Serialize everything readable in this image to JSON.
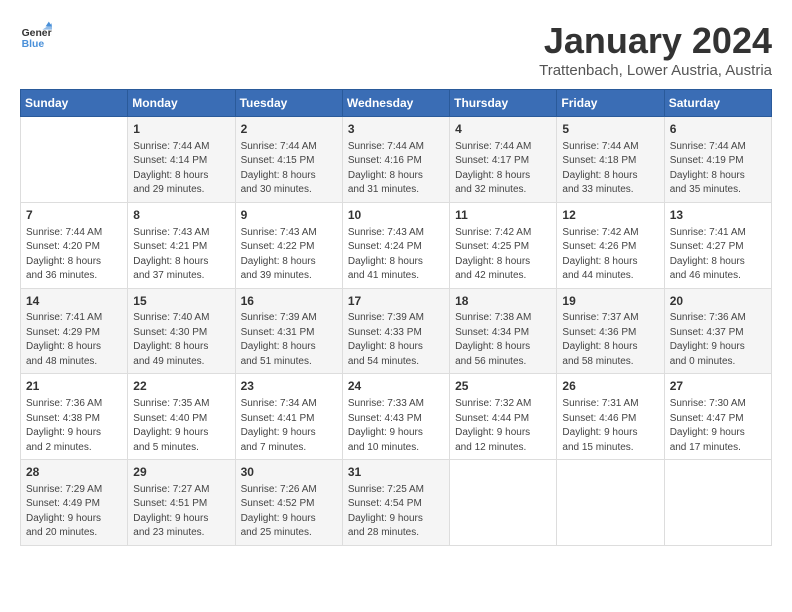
{
  "header": {
    "logo_line1": "General",
    "logo_line2": "Blue",
    "month": "January 2024",
    "location": "Trattenbach, Lower Austria, Austria"
  },
  "weekdays": [
    "Sunday",
    "Monday",
    "Tuesday",
    "Wednesday",
    "Thursday",
    "Friday",
    "Saturday"
  ],
  "weeks": [
    [
      {
        "day": "",
        "text": ""
      },
      {
        "day": "1",
        "text": "Sunrise: 7:44 AM\nSunset: 4:14 PM\nDaylight: 8 hours\nand 29 minutes."
      },
      {
        "day": "2",
        "text": "Sunrise: 7:44 AM\nSunset: 4:15 PM\nDaylight: 8 hours\nand 30 minutes."
      },
      {
        "day": "3",
        "text": "Sunrise: 7:44 AM\nSunset: 4:16 PM\nDaylight: 8 hours\nand 31 minutes."
      },
      {
        "day": "4",
        "text": "Sunrise: 7:44 AM\nSunset: 4:17 PM\nDaylight: 8 hours\nand 32 minutes."
      },
      {
        "day": "5",
        "text": "Sunrise: 7:44 AM\nSunset: 4:18 PM\nDaylight: 8 hours\nand 33 minutes."
      },
      {
        "day": "6",
        "text": "Sunrise: 7:44 AM\nSunset: 4:19 PM\nDaylight: 8 hours\nand 35 minutes."
      }
    ],
    [
      {
        "day": "7",
        "text": "Sunrise: 7:44 AM\nSunset: 4:20 PM\nDaylight: 8 hours\nand 36 minutes."
      },
      {
        "day": "8",
        "text": "Sunrise: 7:43 AM\nSunset: 4:21 PM\nDaylight: 8 hours\nand 37 minutes."
      },
      {
        "day": "9",
        "text": "Sunrise: 7:43 AM\nSunset: 4:22 PM\nDaylight: 8 hours\nand 39 minutes."
      },
      {
        "day": "10",
        "text": "Sunrise: 7:43 AM\nSunset: 4:24 PM\nDaylight: 8 hours\nand 41 minutes."
      },
      {
        "day": "11",
        "text": "Sunrise: 7:42 AM\nSunset: 4:25 PM\nDaylight: 8 hours\nand 42 minutes."
      },
      {
        "day": "12",
        "text": "Sunrise: 7:42 AM\nSunset: 4:26 PM\nDaylight: 8 hours\nand 44 minutes."
      },
      {
        "day": "13",
        "text": "Sunrise: 7:41 AM\nSunset: 4:27 PM\nDaylight: 8 hours\nand 46 minutes."
      }
    ],
    [
      {
        "day": "14",
        "text": "Sunrise: 7:41 AM\nSunset: 4:29 PM\nDaylight: 8 hours\nand 48 minutes."
      },
      {
        "day": "15",
        "text": "Sunrise: 7:40 AM\nSunset: 4:30 PM\nDaylight: 8 hours\nand 49 minutes."
      },
      {
        "day": "16",
        "text": "Sunrise: 7:39 AM\nSunset: 4:31 PM\nDaylight: 8 hours\nand 51 minutes."
      },
      {
        "day": "17",
        "text": "Sunrise: 7:39 AM\nSunset: 4:33 PM\nDaylight: 8 hours\nand 54 minutes."
      },
      {
        "day": "18",
        "text": "Sunrise: 7:38 AM\nSunset: 4:34 PM\nDaylight: 8 hours\nand 56 minutes."
      },
      {
        "day": "19",
        "text": "Sunrise: 7:37 AM\nSunset: 4:36 PM\nDaylight: 8 hours\nand 58 minutes."
      },
      {
        "day": "20",
        "text": "Sunrise: 7:36 AM\nSunset: 4:37 PM\nDaylight: 9 hours\nand 0 minutes."
      }
    ],
    [
      {
        "day": "21",
        "text": "Sunrise: 7:36 AM\nSunset: 4:38 PM\nDaylight: 9 hours\nand 2 minutes."
      },
      {
        "day": "22",
        "text": "Sunrise: 7:35 AM\nSunset: 4:40 PM\nDaylight: 9 hours\nand 5 minutes."
      },
      {
        "day": "23",
        "text": "Sunrise: 7:34 AM\nSunset: 4:41 PM\nDaylight: 9 hours\nand 7 minutes."
      },
      {
        "day": "24",
        "text": "Sunrise: 7:33 AM\nSunset: 4:43 PM\nDaylight: 9 hours\nand 10 minutes."
      },
      {
        "day": "25",
        "text": "Sunrise: 7:32 AM\nSunset: 4:44 PM\nDaylight: 9 hours\nand 12 minutes."
      },
      {
        "day": "26",
        "text": "Sunrise: 7:31 AM\nSunset: 4:46 PM\nDaylight: 9 hours\nand 15 minutes."
      },
      {
        "day": "27",
        "text": "Sunrise: 7:30 AM\nSunset: 4:47 PM\nDaylight: 9 hours\nand 17 minutes."
      }
    ],
    [
      {
        "day": "28",
        "text": "Sunrise: 7:29 AM\nSunset: 4:49 PM\nDaylight: 9 hours\nand 20 minutes."
      },
      {
        "day": "29",
        "text": "Sunrise: 7:27 AM\nSunset: 4:51 PM\nDaylight: 9 hours\nand 23 minutes."
      },
      {
        "day": "30",
        "text": "Sunrise: 7:26 AM\nSunset: 4:52 PM\nDaylight: 9 hours\nand 25 minutes."
      },
      {
        "day": "31",
        "text": "Sunrise: 7:25 AM\nSunset: 4:54 PM\nDaylight: 9 hours\nand 28 minutes."
      },
      {
        "day": "",
        "text": ""
      },
      {
        "day": "",
        "text": ""
      },
      {
        "day": "",
        "text": ""
      }
    ]
  ]
}
